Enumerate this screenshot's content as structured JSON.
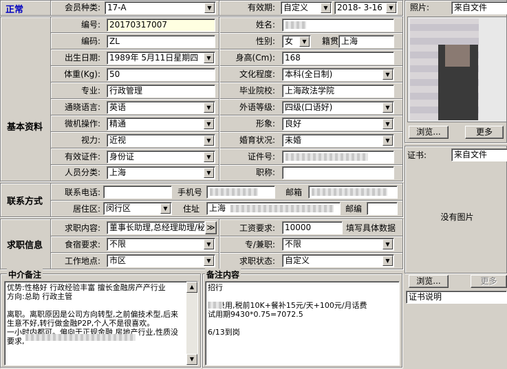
{
  "status": "正常",
  "sections": {
    "basic": "基本资料",
    "contact": "联系方式",
    "job": "求职信息",
    "agent_notes": "中介备注",
    "notes": "备注内容"
  },
  "labels": {
    "member_type": "会员种类:",
    "validity": "有效期:",
    "code": "编号:",
    "short_code": "编码:",
    "birth_date": "出生日期:",
    "weight": "体重(Kg):",
    "major": "专业:",
    "language": "通晓语言:",
    "computer": "微机操作:",
    "vision": "视力:",
    "id_type": "有效证件:",
    "category": "人员分类:",
    "name": "姓名:",
    "gender": "性别:",
    "native": "籍贯",
    "height": "身高(Cm):",
    "education": "文化程度:",
    "school": "毕业院校:",
    "foreign_level": "外语等级:",
    "image": "形象:",
    "marital": "婚育状况:",
    "id_number": "证件号:",
    "title": "职称:",
    "phone": "联系电话:",
    "mobile": "手机号",
    "email": "邮箱",
    "district": "居住区:",
    "address": "住址",
    "postcode": "邮编",
    "job_content": "求职内容:",
    "salary": "工资要求:",
    "housing": "食宿要求:",
    "parttime": "专/兼职:",
    "work_location": "工作地点:",
    "job_status": "求职状态:",
    "photo": "照片:",
    "certificate": "证书:"
  },
  "values": {
    "member_type": "17-A",
    "validity_mode": "自定义",
    "validity_date": "2018- 3-16",
    "code": "20170317007",
    "short_code": "ZL",
    "birth_date": "1989年 5月11日星期四",
    "weight": "50",
    "major": "行政管理",
    "language": "英语",
    "computer": "精通",
    "vision": "近视",
    "id_type": "身份证",
    "category": "上海",
    "gender": "女",
    "native": "上海",
    "height": "168",
    "education": "本科(全日制)",
    "school": "上海政法学院",
    "foreign_level": "四级(口语好)",
    "image": "良好",
    "marital": "未婚",
    "district": "闵行区",
    "address": "上海",
    "job_content": "董事长助理,总经理助理/秘",
    "salary": "10000",
    "salary_hint": "填写具体数据",
    "housing": "不限",
    "parttime": "不限",
    "work_location": "市区",
    "job_status": "自定义",
    "photo_source": "来自文件",
    "cert_source": "来自文件",
    "cert_desc": "证书说明",
    "no_image": "没有图片"
  },
  "buttons": {
    "browse": "浏览...",
    "more": "更多",
    "expand": "≫"
  },
  "agent_notes_text": "优势:性格好 行政经验丰富 擅长金融房产产行业\n方向:总助 行政主管\n\n离职。离职原因是公司方向转型,之前偏技术型,后来生意不好,转行做金融P2P,个人不是很喜欢。                                一小时内都可。偏向于正规金融 房地产行业,性质没要求,",
  "notes_text": "招行\n\n    录用,税前10K+餐补15元/天+100元/月话费\n试用期9430*0.75=7072.5\n\n6/13到岗"
}
